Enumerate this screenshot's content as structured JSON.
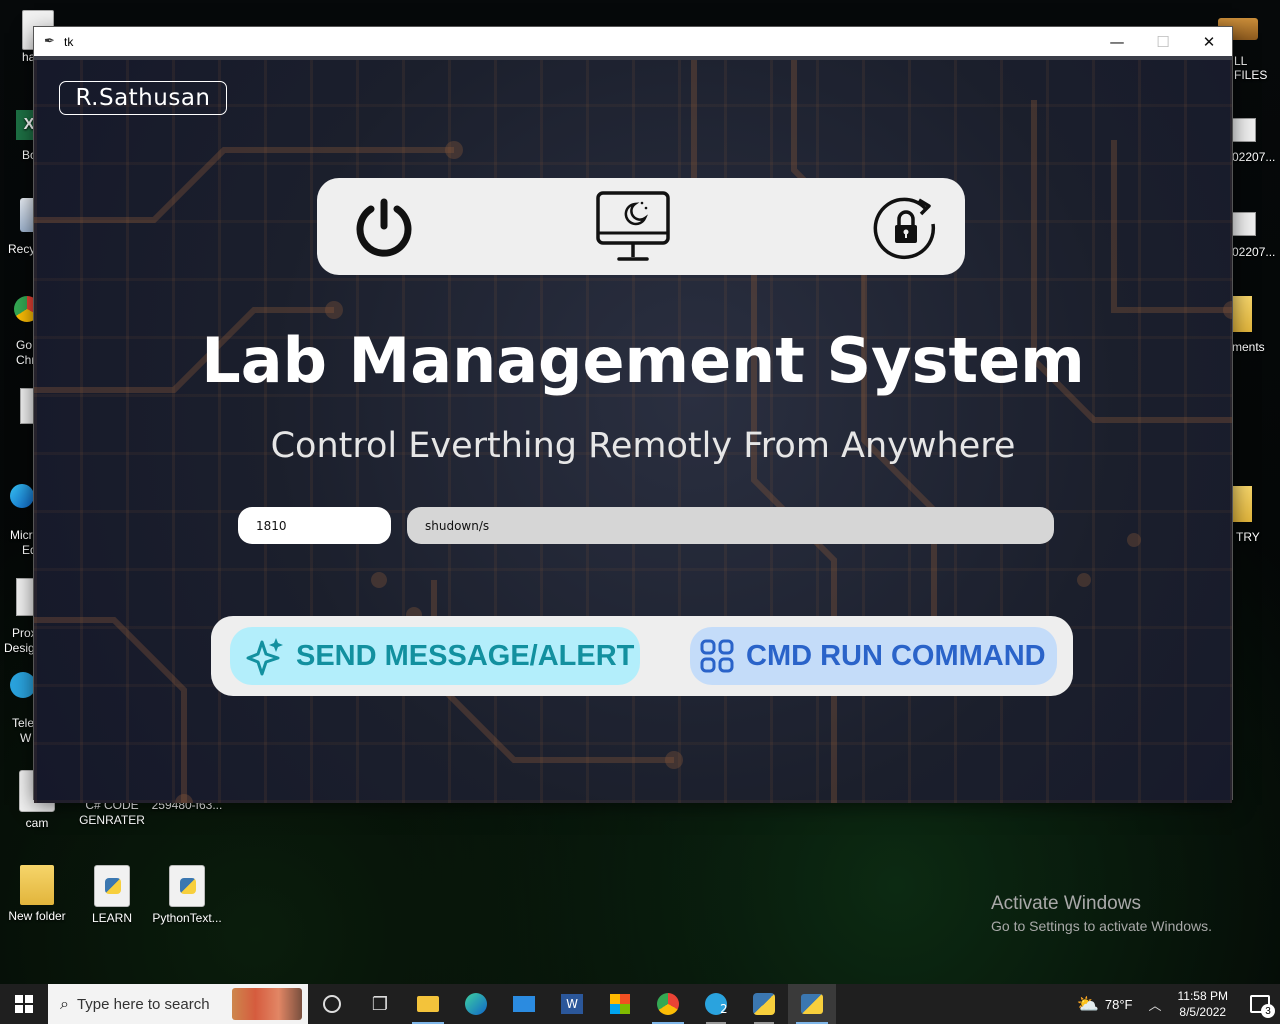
{
  "desktop": {
    "left_labels": [
      "ha",
      "Bo",
      "Recy",
      "Go",
      "Chr",
      "Micr",
      "Ed",
      "Prox",
      "Desig",
      "Tele",
      "W"
    ],
    "right_labels": [
      "LL FILES",
      "02207...",
      "02207...",
      "ments",
      "TRY"
    ],
    "icons": [
      {
        "label": "cam"
      },
      {
        "label_line1": "C# CODE",
        "label_line2": "GENRATER"
      },
      {
        "label": "259480-f63..."
      },
      {
        "label": "New folder"
      },
      {
        "label": "LEARN"
      },
      {
        "label": "PythonText..."
      }
    ]
  },
  "window": {
    "title": "tk",
    "controls": {
      "minimize": "—",
      "maximize": "☐",
      "close": "✕"
    }
  },
  "app": {
    "author_badge": "R.Sathusan",
    "icon_bar": {
      "shutdown_icon": "power-icon",
      "sleep_icon": "monitor-sleep-icon",
      "lock_icon": "lock-rotate-icon"
    },
    "title": "Lab Management System",
    "subtitle": "Control Everthing Remotly From Anywhere",
    "port_value": "1810",
    "command_value": "shudown/s",
    "buttons": {
      "alert_label": "SEND MESSAGE/ALERT",
      "cmd_label": "CMD RUN COMMAND"
    },
    "colors": {
      "alert_bg": "#b3eefb",
      "alert_text": "#12909f",
      "cmd_bg": "#c4dcf9",
      "cmd_text": "#2a63c9"
    }
  },
  "watermark": {
    "line1": "Activate Windows",
    "line2": "Go to Settings to activate Windows."
  },
  "taskbar": {
    "search_placeholder": "Type here to search",
    "weather": "78°F",
    "time": "11:58 PM",
    "date": "8/5/2022",
    "notification_count": "3",
    "telegram_badge": "2"
  }
}
